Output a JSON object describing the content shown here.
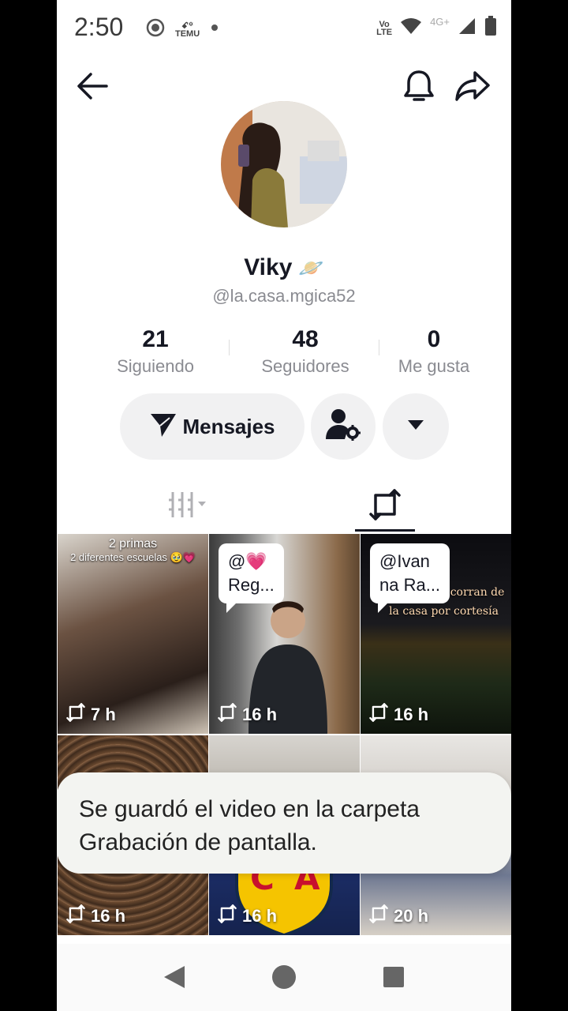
{
  "status_bar": {
    "time": "2:50",
    "temu_label_top": "ꗃ꙳",
    "temu_label": "TEMU",
    "volte_top": "Vo",
    "volte_bottom": "LTE",
    "network": "4G+"
  },
  "profile": {
    "display_name": "Viky",
    "name_emoji": "🪐",
    "username": "@la.casa.mgica52"
  },
  "stats": {
    "following_count": "21",
    "following_label": "Siguiendo",
    "followers_count": "48",
    "followers_label": "Seguidores",
    "likes_count": "0",
    "likes_label": "Me gusta"
  },
  "actions": {
    "messages_label": "Mensajes"
  },
  "videos": [
    {
      "time": "7 h",
      "caption_line1": "2 primas",
      "caption_line2": "2 diferentes escuelas 🥹💗"
    },
    {
      "time": "16 h",
      "mention": "@💗\nReg..."
    },
    {
      "time": "16 h",
      "mention": "@Ivan\nna Ra...",
      "overlay": "cuando nos corran de la casa por cortesía"
    },
    {
      "time": "16 h"
    },
    {
      "time": "16 h"
    },
    {
      "time": "20 h"
    }
  ],
  "toast": {
    "message": "Se guardó el video en la carpeta Grabación de pantalla."
  },
  "colors": {
    "text_primary": "#161823",
    "text_secondary": "#8a8b91",
    "button_bg": "#f1f1f2"
  }
}
